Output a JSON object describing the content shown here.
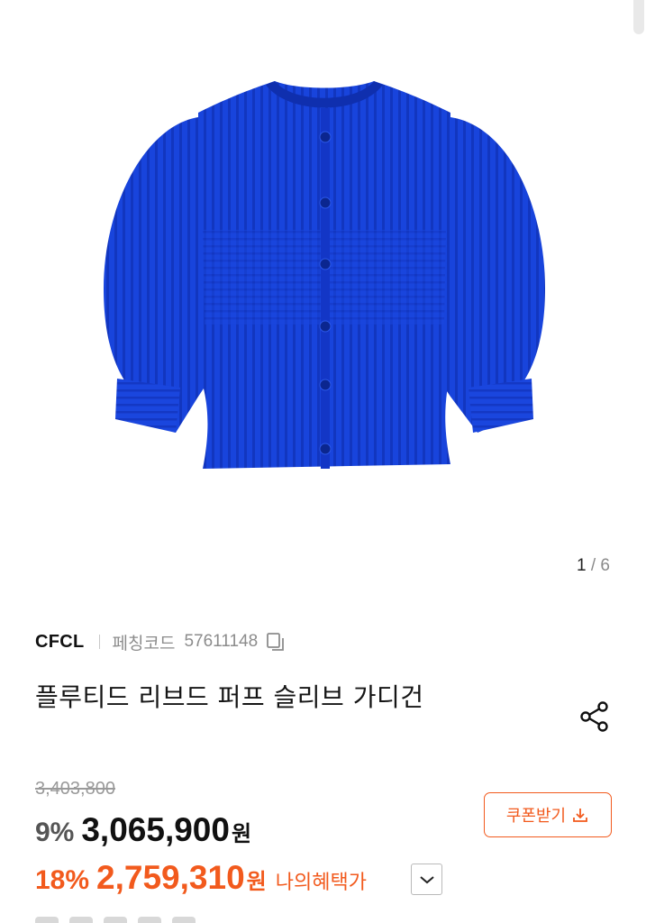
{
  "gallery": {
    "current": "1",
    "separator": "/",
    "total": "6"
  },
  "product": {
    "brand": "CFCL",
    "code_label": "페칭코드",
    "code_value": "57611148",
    "title": "플루티드 리브드 퍼프 슬리브 가디건",
    "image_icon": "blue-ribbed-cardigan-image"
  },
  "pricing": {
    "original_price": "3,403,800",
    "discount_percent": "9%",
    "sale_price": "3,065,900",
    "currency": "원",
    "member_discount_percent": "18%",
    "member_price": "2,759,310",
    "member_currency": "원",
    "member_label": "나의혜택가"
  },
  "actions": {
    "coupon_label": "쿠폰받기",
    "share_icon": "share-icon",
    "copy_icon": "copy-icon",
    "download_icon": "download-icon",
    "chevron_icon": "chevron-down-icon"
  },
  "colors": {
    "accent": "#f25a1d",
    "product_blue": "#1740d9",
    "muted": "#8c8c8c"
  }
}
